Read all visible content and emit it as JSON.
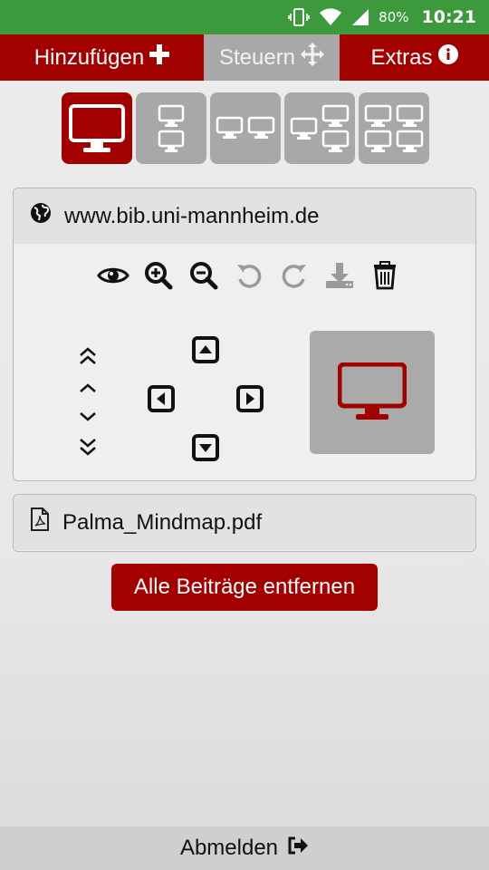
{
  "status_bar": {
    "battery": "80%",
    "time": "10:21",
    "icons": [
      "vibrate-icon",
      "wifi-icon",
      "signal-icon",
      "battery-icon"
    ]
  },
  "tabs": [
    {
      "label": "Hinzufügen",
      "icon": "plus-icon"
    },
    {
      "label": "Steuern",
      "icon": "move-icon"
    },
    {
      "label": "Extras",
      "icon": "info-icon"
    }
  ],
  "layouts": {
    "selected": 0,
    "options": [
      "layout-1-screen",
      "layout-2-stacked",
      "layout-2-side",
      "layout-3",
      "layout-4"
    ]
  },
  "web_card": {
    "url": "www.bib.uni-mannheim.de",
    "tools": [
      "eye-icon",
      "zoom-in-icon",
      "zoom-out-icon",
      "undo-icon",
      "redo-icon",
      "download-icon",
      "trash-icon"
    ]
  },
  "file_card": {
    "filename": "Palma_Mindmap.pdf"
  },
  "remove_all_label": "Alle Beiträge entfernen",
  "logout_label": "Abmelden",
  "colors": {
    "accent": "#a30000",
    "status_bar": "#3c9a3c",
    "inactive": "#a8a8a8"
  }
}
